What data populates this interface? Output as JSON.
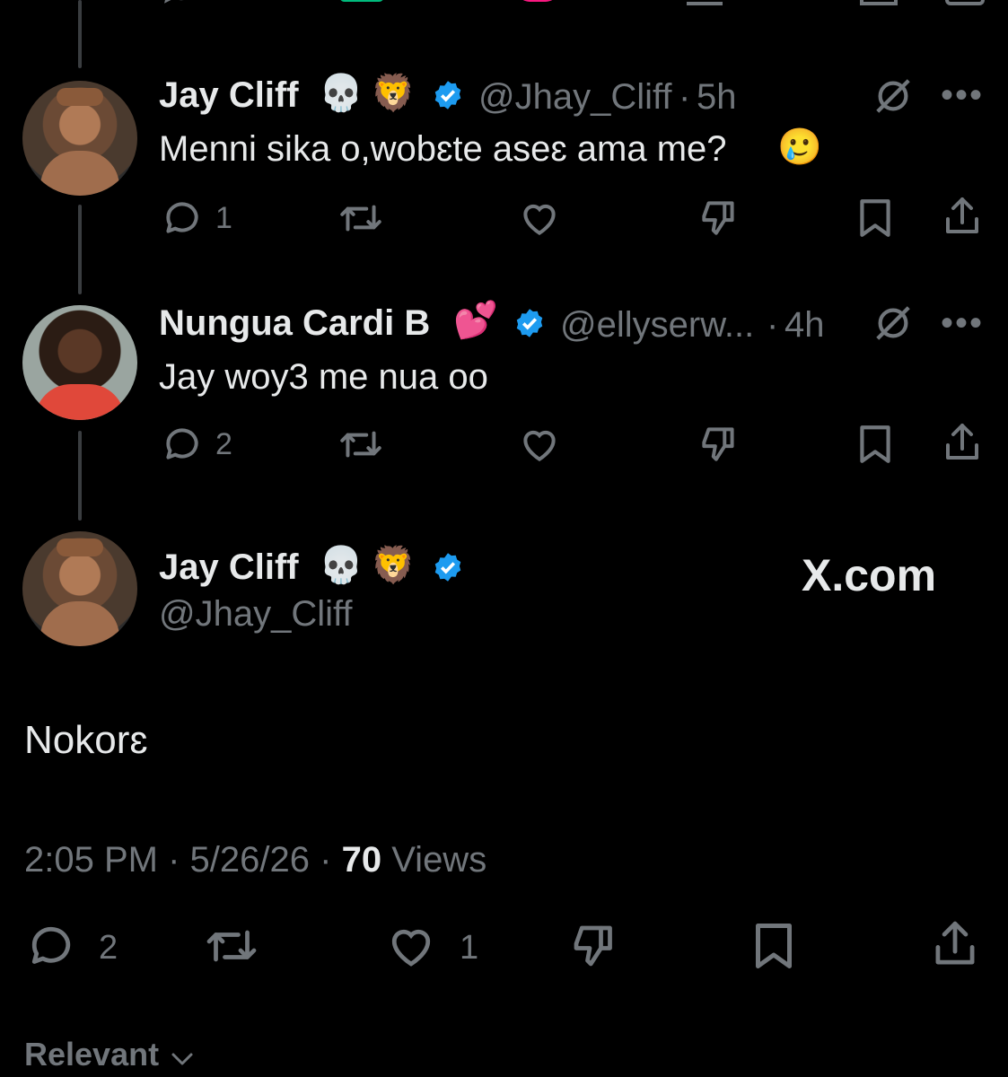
{
  "thread": [
    {
      "name": "Jay Cliff",
      "emojis": [
        "💀",
        "🦁"
      ],
      "handle": "@Jhay_Cliff",
      "time": "5h",
      "text": "Menni sika o,wobɛte aseɛ ama me?",
      "text_emoji": "🥲",
      "replies": "1"
    },
    {
      "name": "Nungua Cardi B",
      "emojis": [
        "💕"
      ],
      "handle": "@ellyserw...",
      "time": "4h",
      "text": "Jay woy3 me nua oo",
      "replies": "2"
    }
  ],
  "main": {
    "name": "Jay Cliff",
    "emojis": [
      "💀",
      "🦁"
    ],
    "handle": "@Jhay_Cliff",
    "brand": "X.com",
    "text": "Nokorɛ",
    "time": "2:05 PM",
    "date": "5/26/26",
    "views_count": "70",
    "views_label": "Views",
    "replies": "2",
    "likes": "1"
  },
  "sort": {
    "label": "Relevant"
  },
  "separator": "·",
  "colors": {
    "verified": "#1d9bf0",
    "muted": "#71767b",
    "text": "#e7e9ea",
    "background": "#000000"
  }
}
